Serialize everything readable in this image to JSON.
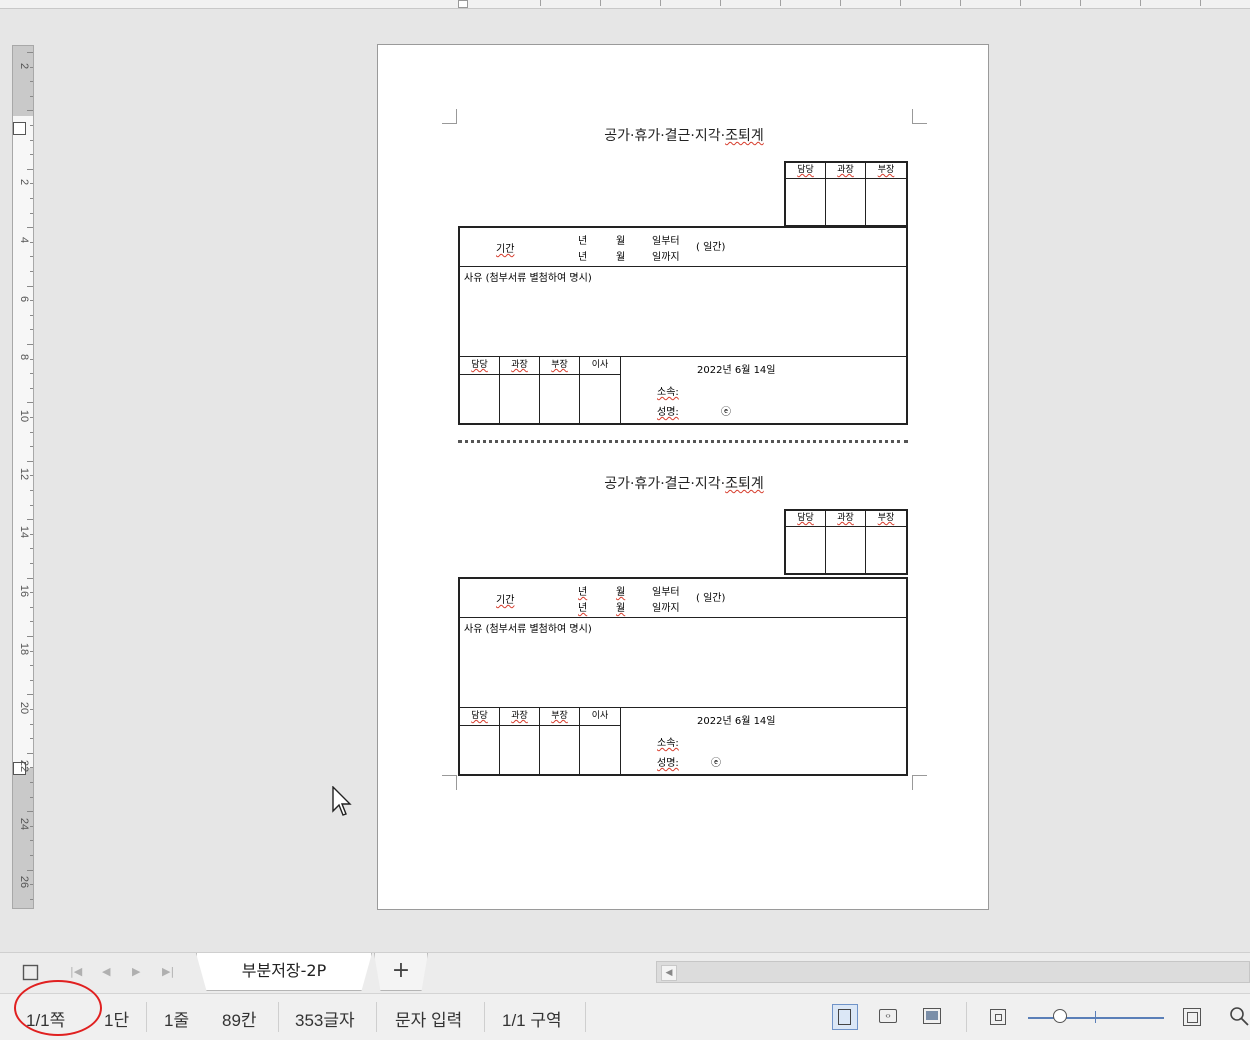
{
  "vertical_ruler": {
    "labels": [
      "2",
      "2",
      "4",
      "6",
      "8",
      "10",
      "12",
      "14",
      "16",
      "18",
      "20",
      "22",
      "24",
      "26"
    ]
  },
  "form": {
    "title_parts": [
      "공가·휴가·결근·지각·",
      "조퇴계"
    ],
    "approval_headers": [
      "담당",
      "과장",
      "부장"
    ],
    "period_label": "기간",
    "year_unit": "년",
    "month_unit": "월",
    "from_text": "일부터",
    "to_text": "일까지",
    "days_text": "(      일간)",
    "reason_text": "사유 (첨부서류 별첨하여 명시)",
    "stamp_headers": [
      "담당",
      "과장",
      "부장",
      "이사"
    ],
    "date_text": "2022년 6월 14일",
    "dept_label": "소속:",
    "name_label": "성명:",
    "seal_mark": "ⓔ"
  },
  "sheet_tabs": {
    "active": "부분저장-2P",
    "add_label": "+"
  },
  "status": {
    "page": "1/1쪽",
    "column": "1단",
    "line": "1줄",
    "cell": "89칸",
    "chars": "353글자",
    "mode": "문자 입력",
    "section": "1/1 구역"
  }
}
